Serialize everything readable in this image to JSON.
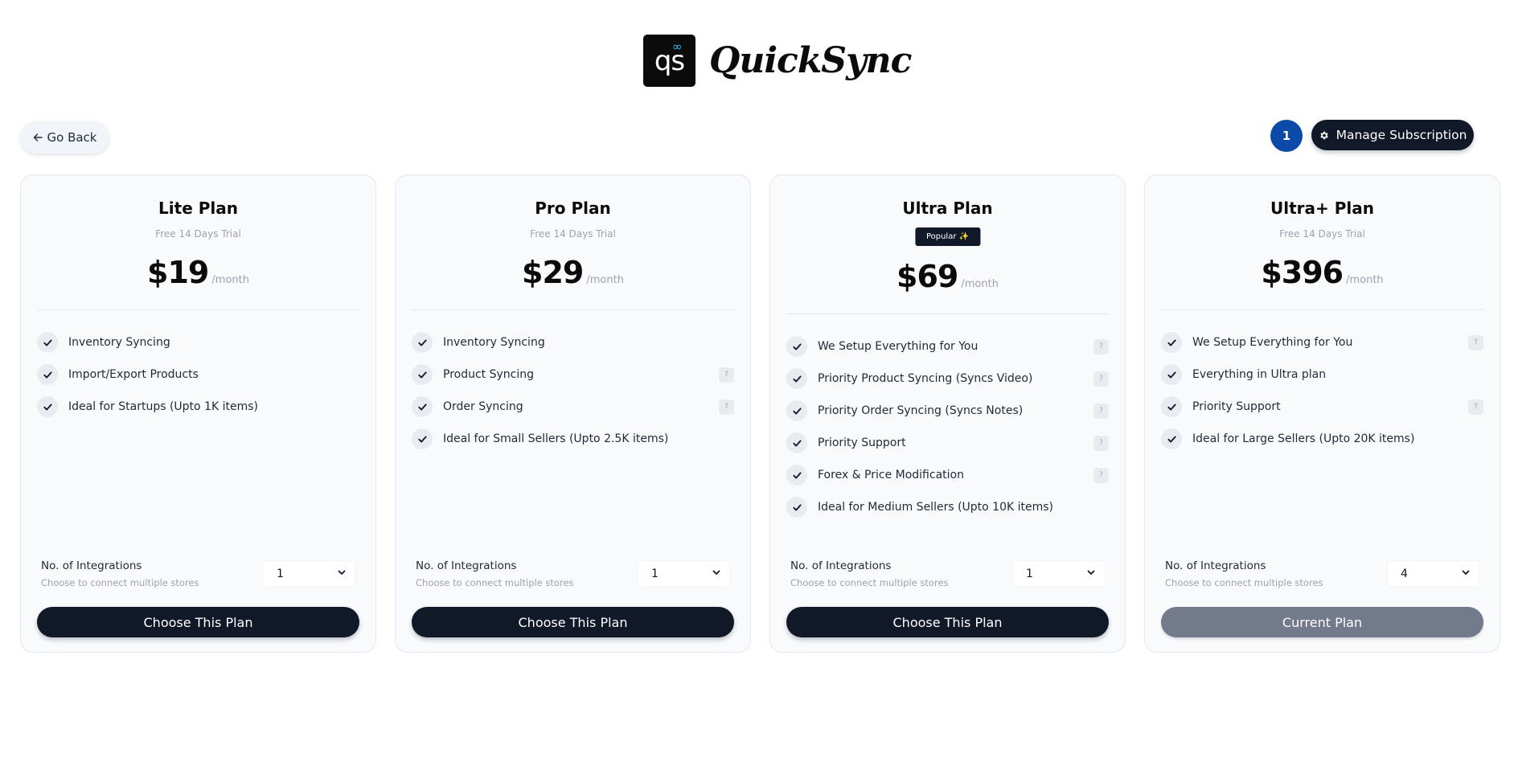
{
  "brand": {
    "logo_mark": "qs",
    "logo_accent": "∞",
    "name": "QuickSync"
  },
  "header": {
    "go_back_label": "Go Back",
    "notification_count": "1",
    "manage_label": "Manage Subscription"
  },
  "colors": {
    "dark": "#111827",
    "accent_blue": "#0b4aa8",
    "current_plan": "#737a8c",
    "card_bg": "#f8fafc"
  },
  "plans": [
    {
      "title": "Lite Plan",
      "subtitle": "Free 14 Days Trial",
      "price": "$19",
      "per": "/month",
      "features": [
        {
          "text": "Inventory Syncing",
          "help": false
        },
        {
          "text": "Import/Export Products",
          "help": false
        },
        {
          "text": "Ideal for Startups (Upto 1K items)",
          "help": false
        }
      ],
      "integrations_label": "No. of Integrations",
      "integrations_sub": "Choose to connect multiple stores",
      "integrations_value": "1",
      "button_label": "Choose This Plan",
      "current": false
    },
    {
      "title": "Pro Plan",
      "subtitle": "Free 14 Days Trial",
      "price": "$29",
      "per": "/month",
      "features": [
        {
          "text": "Inventory Syncing",
          "help": false
        },
        {
          "text": "Product Syncing",
          "help": true
        },
        {
          "text": "Order Syncing",
          "help": true
        },
        {
          "text": "Ideal for Small Sellers (Upto 2.5K items)",
          "help": false
        }
      ],
      "integrations_label": "No. of Integrations",
      "integrations_sub": "Choose to connect multiple stores",
      "integrations_value": "1",
      "button_label": "Choose This Plan",
      "current": false
    },
    {
      "title": "Ultra Plan",
      "badge": "Popular ✨",
      "price": "$69",
      "per": "/month",
      "features": [
        {
          "text": "We Setup Everything for You",
          "help": true
        },
        {
          "text": "Priority Product Syncing (Syncs Video)",
          "help": true
        },
        {
          "text": "Priority Order Syncing (Syncs Notes)",
          "help": true
        },
        {
          "text": "Priority Support",
          "help": true
        },
        {
          "text": "Forex & Price Modification",
          "help": true
        },
        {
          "text": "Ideal for Medium Sellers (Upto 10K items)",
          "help": false
        }
      ],
      "integrations_label": "No. of Integrations",
      "integrations_sub": "Choose to connect multiple stores",
      "integrations_value": "1",
      "button_label": "Choose This Plan",
      "current": false
    },
    {
      "title": "Ultra+ Plan",
      "subtitle": "Free 14 Days Trial",
      "price": "$396",
      "per": "/month",
      "features": [
        {
          "text": "We Setup Everything for You",
          "help": true
        },
        {
          "text": "Everything in Ultra plan",
          "help": false
        },
        {
          "text": "Priority Support",
          "help": true
        },
        {
          "text": "Ideal for Large Sellers (Upto 20K items)",
          "help": false
        }
      ],
      "integrations_label": "No. of Integrations",
      "integrations_sub": "Choose to connect multiple stores",
      "integrations_value": "4",
      "button_label": "Current Plan",
      "current": true
    }
  ]
}
